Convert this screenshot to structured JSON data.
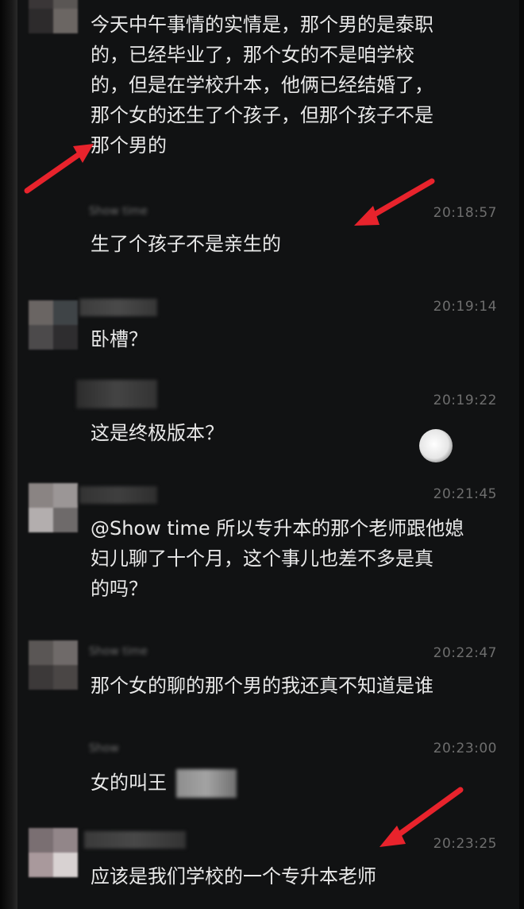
{
  "messages": [
    {
      "sender": "",
      "time": "",
      "text": "今天中午事情的实情是，那个男的是泰职\n的，已经毕业了，那个女的不是咱学校\n的，但是在学校升本，他俩已经结婚了，\n那个女的还生了个孩子，但那个孩子不是\n那个男的"
    },
    {
      "sender": "Show time",
      "time": "20:18:57",
      "text": "生了个孩子不是亲生的"
    },
    {
      "sender": "",
      "time": "20:19:14",
      "text": "卧槽？"
    },
    {
      "sender": "",
      "time": "20:19:22",
      "text": "这是终极版本？"
    },
    {
      "sender": "",
      "time": "20:21:45",
      "text": "@Show time 所以专升本的那个老师跟他媳\n妇儿聊了十个月，这个事儿也差不多是真\n的吗？"
    },
    {
      "sender": "Show time",
      "time": "20:22:47",
      "text": "那个女的聊的那个男的我还真不知道是谁"
    },
    {
      "sender": "Show",
      "time": "20:23:00",
      "text": "女的叫王"
    },
    {
      "sender": "",
      "time": "20:23:25",
      "text": "应该是我们学校的一个专升本老师"
    }
  ],
  "colors": {
    "background": "#111213",
    "message_text": "#e8e8e8",
    "timestamp": "#6e6e6e",
    "arrow": "#e8232c"
  },
  "icons": [
    "arrow-annotation-icon",
    "moon-icon"
  ]
}
